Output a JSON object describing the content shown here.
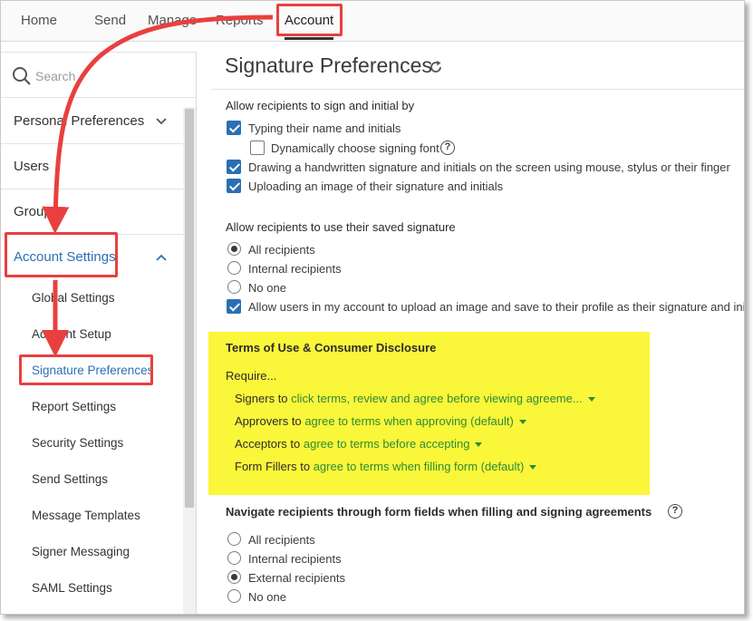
{
  "topnav": {
    "items": [
      "Home",
      "Send",
      "Manage",
      "Reports"
    ],
    "active": "Account"
  },
  "sidebar": {
    "search_placeholder": "Search",
    "items": [
      {
        "label": "Personal Preferences"
      },
      {
        "label": "Users"
      },
      {
        "label": "Groups"
      },
      {
        "label": "Account Settings"
      }
    ],
    "subitems": [
      "Global Settings",
      "Account Setup",
      "Signature Preferences",
      "Report Settings",
      "Security Settings",
      "Send Settings",
      "Message Templates",
      "Signer Messaging",
      "SAML Settings"
    ]
  },
  "main": {
    "title": "Signature Preferences",
    "sign_section": {
      "heading": "Allow recipients to sign and initial by",
      "options": [
        {
          "label": "Typing their name and initials",
          "checked": true
        },
        {
          "label": "Dynamically choose signing font",
          "checked": false
        },
        {
          "label": "Drawing a handwritten signature and initials on the screen using mouse, stylus or their finger",
          "checked": true
        },
        {
          "label": "Uploading an image of their signature and initials",
          "checked": true
        }
      ]
    },
    "saved_section": {
      "heading": "Allow recipients to use their saved signature",
      "radios": [
        {
          "label": "All recipients",
          "selected": true
        },
        {
          "label": "Internal recipients",
          "selected": false
        },
        {
          "label": "No one",
          "selected": false
        }
      ],
      "upload_option": {
        "label": "Allow users in my account to upload an image and save to their profile as their signature and initials",
        "checked": true
      }
    },
    "terms_section": {
      "heading": "Terms of Use & Consumer Disclosure",
      "require_label": "Require...",
      "rows": [
        {
          "who": "Signers to",
          "value": "click terms, review and agree before viewing agreeme..."
        },
        {
          "who": "Approvers to",
          "value": "agree to terms when approving (default)"
        },
        {
          "who": "Acceptors to",
          "value": "agree to terms before accepting"
        },
        {
          "who": "Form Fillers to",
          "value": "agree to terms when filling form (default)"
        }
      ]
    },
    "navigate_section": {
      "heading": "Navigate recipients through form fields when filling and signing agreements",
      "radios": [
        {
          "label": "All recipients",
          "selected": false
        },
        {
          "label": "Internal recipients",
          "selected": false
        },
        {
          "label": "External recipients",
          "selected": true
        },
        {
          "label": "No one",
          "selected": false
        }
      ]
    }
  },
  "colors": {
    "highlight": "#faf63a",
    "annotation": "#e8403f",
    "link_green": "#2e8b37",
    "checkbox_blue": "#2b6fb5"
  }
}
